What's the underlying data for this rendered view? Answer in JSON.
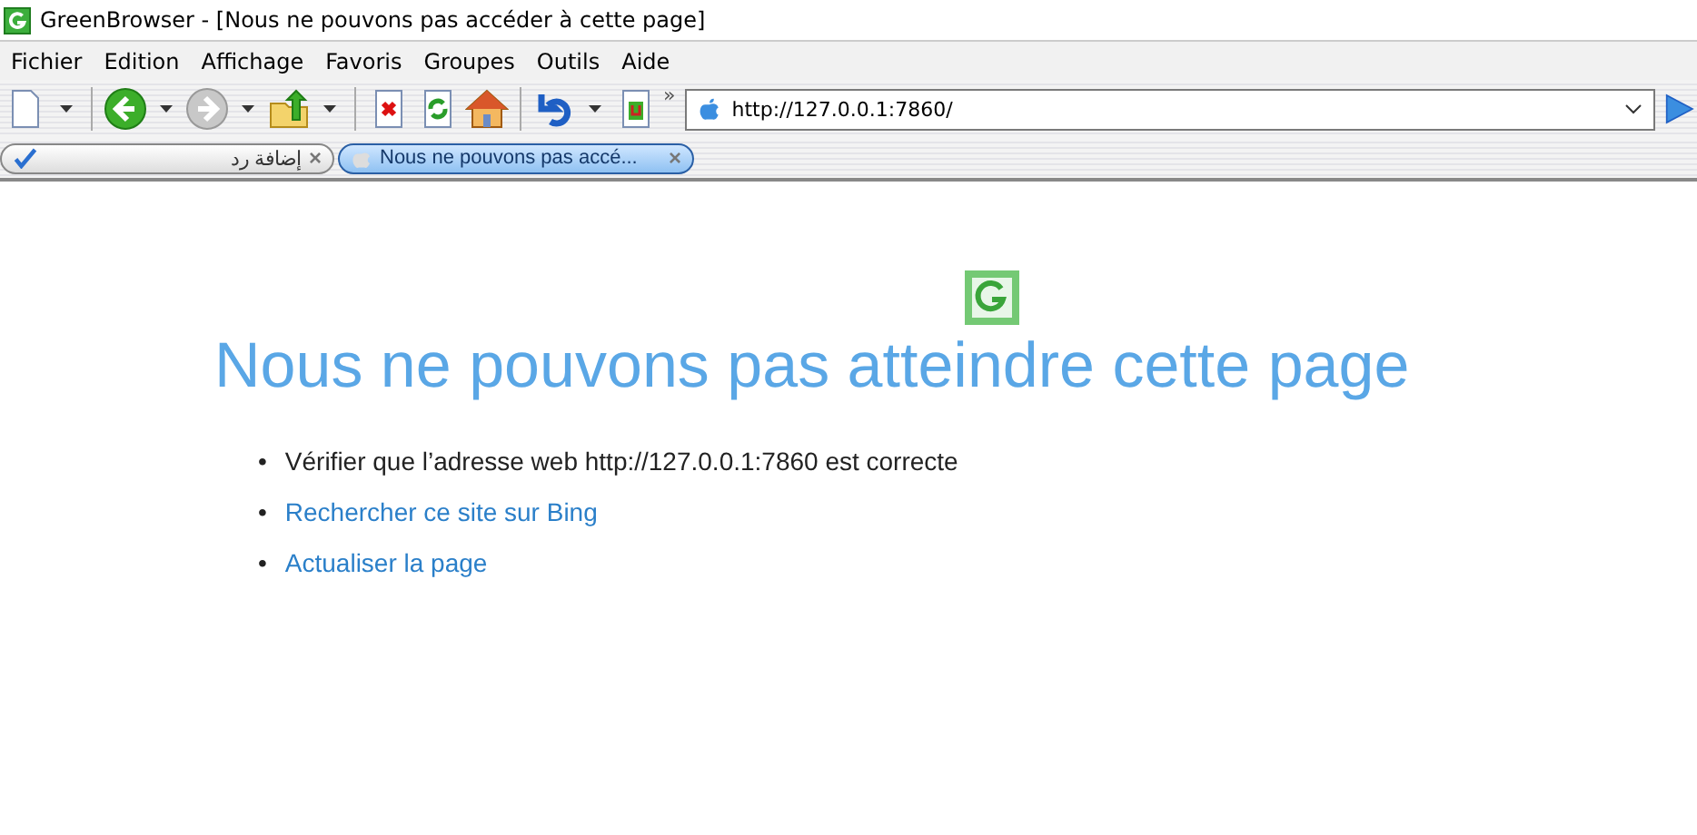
{
  "window": {
    "title": "GreenBrowser - [Nous ne pouvons pas accéder à cette page]"
  },
  "menu": [
    "Fichier",
    "Edition",
    "Affichage",
    "Favoris",
    "Groupes",
    "Outils",
    "Aide"
  ],
  "toolbar": {
    "chevron": "»",
    "address": "http://127.0.0.1:7860/"
  },
  "tabs": [
    {
      "label": "إضافة رد",
      "selected": false,
      "close": "×"
    },
    {
      "label": "Nous ne pouvons pas accé...",
      "selected": true,
      "close": "×"
    }
  ],
  "page": {
    "heading": "Nous ne pouvons pas atteindre cette page",
    "items": [
      {
        "kind": "text",
        "bullet": "•",
        "text": "Vérifier que l’adresse web http://127.0.0.1:7860 est correcte"
      },
      {
        "kind": "link",
        "bullet": "•",
        "text": "Rechercher ce site sur Bing"
      },
      {
        "kind": "link",
        "bullet": "•",
        "text": "Actualiser la page"
      }
    ]
  }
}
